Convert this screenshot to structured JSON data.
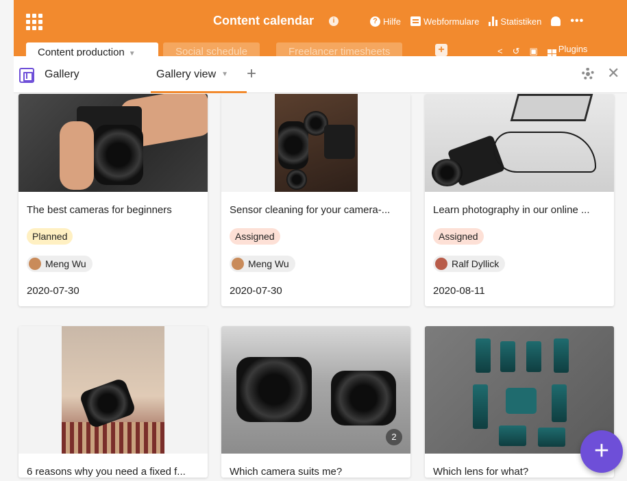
{
  "header": {
    "base_title": "Content calendar",
    "actions": [
      {
        "label": "Hilfe",
        "icon": "help-icon"
      },
      {
        "label": "Webformulare",
        "icon": "form-icon"
      },
      {
        "label": "Statistiken",
        "icon": "stats-icon"
      }
    ],
    "bell_icon": "bell-icon",
    "more_icon": "more-icon"
  },
  "tables": {
    "active": "Content production",
    "others": [
      "Social schedule",
      "Freelancer timesheets"
    ],
    "add_icon": "add-table-icon"
  },
  "toolbar_right": {
    "plugins_label": "Plugins"
  },
  "view": {
    "app_label": "Gallery",
    "current_view": "Gallery view",
    "add_icon": "add-view-icon",
    "settings_icon": "settings-icon",
    "close_icon": "close-icon"
  },
  "cards": [
    {
      "title": "The best cameras for beginners",
      "status": "Planned",
      "status_color": "#fff0c2",
      "assignee": "Meng Wu",
      "date": "2020-07-30"
    },
    {
      "title": "Sensor cleaning for your camera-...",
      "status": "Assigned",
      "status_color": "#fde0d6",
      "assignee": "Meng Wu",
      "date": "2020-07-30"
    },
    {
      "title": "Learn photography in our online ...",
      "status": "Assigned",
      "status_color": "#fde0d6",
      "assignee": "Ralf Dyllick",
      "date": "2020-08-11"
    },
    {
      "title": "6 reasons why you need a fixed f...",
      "image_count": ""
    },
    {
      "title": "Which camera suits me?",
      "image_count": "2"
    },
    {
      "title": "Which lens for what?",
      "image_count": ""
    }
  ],
  "fab_label": "+",
  "colors": {
    "brand": "#f28a2e",
    "accent": "#6e4fd8"
  }
}
